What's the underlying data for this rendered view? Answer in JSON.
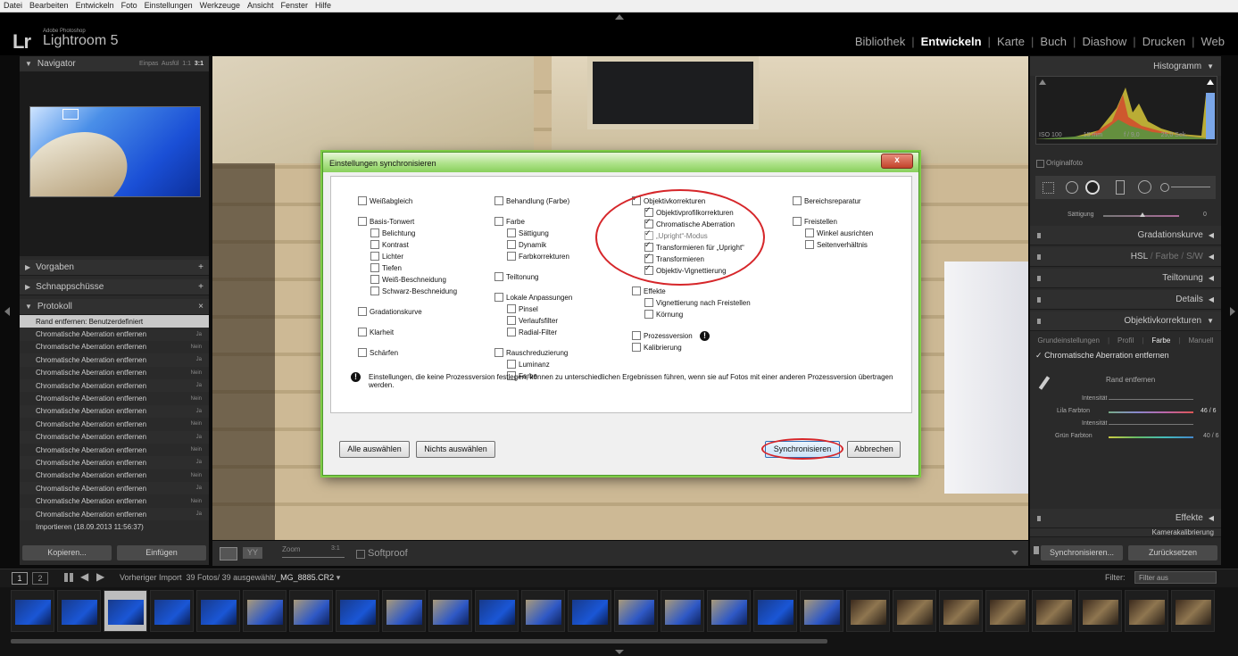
{
  "menubar": [
    "Datei",
    "Bearbeiten",
    "Entwickeln",
    "Foto",
    "Einstellungen",
    "Werkzeuge",
    "Ansicht",
    "Fenster",
    "Hilfe"
  ],
  "app": {
    "mark": "Lr",
    "small": "Adobe Photoshop",
    "name": "Lightroom 5"
  },
  "modules": [
    {
      "label": "Bibliothek",
      "active": false
    },
    {
      "label": "Entwickeln",
      "active": true
    },
    {
      "label": "Karte",
      "active": false
    },
    {
      "label": "Buch",
      "active": false
    },
    {
      "label": "Diashow",
      "active": false
    },
    {
      "label": "Drucken",
      "active": false
    },
    {
      "label": "Web",
      "active": false
    }
  ],
  "left": {
    "navigator": {
      "title": "Navigator",
      "opts": [
        "Einpas",
        "Ausfül",
        "1:1"
      ],
      "opt_active": "3:1"
    },
    "presets": "Vorgaben",
    "snapshots": "Schnappschüsse",
    "history": "Protokoll",
    "history_items": [
      {
        "label": "Rand entfernen: Benutzerdefiniert",
        "value": "",
        "selected": true
      },
      {
        "label": "Chromatische Aberration entfernen",
        "value": "Ja"
      },
      {
        "label": "Chromatische Aberration entfernen",
        "value": "Nein"
      },
      {
        "label": "Chromatische Aberration entfernen",
        "value": "Ja"
      },
      {
        "label": "Chromatische Aberration entfernen",
        "value": "Nein"
      },
      {
        "label": "Chromatische Aberration entfernen",
        "value": "Ja"
      },
      {
        "label": "Chromatische Aberration entfernen",
        "value": "Nein"
      },
      {
        "label": "Chromatische Aberration entfernen",
        "value": "Ja"
      },
      {
        "label": "Chromatische Aberration entfernen",
        "value": "Nein"
      },
      {
        "label": "Chromatische Aberration entfernen",
        "value": "Ja"
      },
      {
        "label": "Chromatische Aberration entfernen",
        "value": "Nein"
      },
      {
        "label": "Chromatische Aberration entfernen",
        "value": "Ja"
      },
      {
        "label": "Chromatische Aberration entfernen",
        "value": "Nein"
      },
      {
        "label": "Chromatische Aberration entfernen",
        "value": "Ja"
      },
      {
        "label": "Chromatische Aberration entfernen",
        "value": "Nein"
      },
      {
        "label": "Chromatische Aberration entfernen",
        "value": "Ja"
      },
      {
        "label": "Importieren (18.09.2013 11:56:37)",
        "value": ""
      }
    ],
    "copy_btn": "Kopieren...",
    "paste_btn": "Einfügen"
  },
  "toolbar": {
    "zoom": "Zoom",
    "zoom_val": "3:1",
    "softproof": "Softproof"
  },
  "right": {
    "histogram": "Histogramm",
    "exif": [
      "ISO 100",
      "15 mm",
      "f / 9,0",
      "25,0 Sek."
    ],
    "original": "Originalfoto",
    "saturation": "Sättigung",
    "saturation_val": "0",
    "tone_curve": "Gradationskurve",
    "hsl": [
      "HSL",
      "/",
      "Farbe",
      "/",
      "S/W"
    ],
    "split": "Teiltonung",
    "details": "Details",
    "lens": "Objektivkorrekturen",
    "lens_tabs": [
      "Grundeinstellungen",
      "|",
      "Profil",
      "|",
      "Farbe",
      "|",
      "Manuell"
    ],
    "ca_remove": "Chromatische Aberration entfernen",
    "defringe": "Rand entfernen",
    "intensity": "Intensität",
    "purple_hue": "Lila Farbton",
    "purple_val": "46 / 6",
    "intensity2": "Intensität",
    "green_hue": "Grün Farbton",
    "green_val": "40 / 6",
    "effects": "Effekte",
    "camera_cal": "Kamerakalibrierung",
    "sync_btn": "Synchronisieren...",
    "reset_btn": "Zurücksetzen"
  },
  "filmbar": {
    "views": [
      "1",
      "2"
    ],
    "source": "Vorheriger Import",
    "count": "39 Fotos/ 39 ausgewählt/",
    "file": "_MG_8885.CR2",
    "filter_label": "Filter:",
    "filter_val": "Filter aus"
  },
  "dialog": {
    "title": "Einstellungen synchronisieren",
    "close": "x",
    "col1": [
      {
        "label": "Weißabgleich",
        "checked": false,
        "indent": 0
      },
      {
        "label": "Basis-Tonwert",
        "checked": false,
        "indent": 0
      },
      {
        "label": "Belichtung",
        "checked": false,
        "indent": 1
      },
      {
        "label": "Kontrast",
        "checked": false,
        "indent": 1
      },
      {
        "label": "Lichter",
        "checked": false,
        "indent": 1
      },
      {
        "label": "Tiefen",
        "checked": false,
        "indent": 1
      },
      {
        "label": "Weiß-Beschneidung",
        "checked": false,
        "indent": 1
      },
      {
        "label": "Schwarz-Beschneidung",
        "checked": false,
        "indent": 1
      },
      {
        "label": "Gradationskurve",
        "checked": false,
        "indent": 0
      },
      {
        "label": "Klarheit",
        "checked": false,
        "indent": 0
      },
      {
        "label": "Schärfen",
        "checked": false,
        "indent": 0
      }
    ],
    "col2": [
      {
        "label": "Behandlung (Farbe)",
        "checked": false,
        "indent": 0
      },
      {
        "label": "Farbe",
        "checked": false,
        "indent": 0
      },
      {
        "label": "Sättigung",
        "checked": false,
        "indent": 1
      },
      {
        "label": "Dynamik",
        "checked": false,
        "indent": 1
      },
      {
        "label": "Farbkorrekturen",
        "checked": false,
        "indent": 1
      },
      {
        "label": "Teiltonung",
        "checked": false,
        "indent": 0
      },
      {
        "label": "Lokale Anpassungen",
        "checked": false,
        "indent": 0
      },
      {
        "label": "Pinsel",
        "checked": false,
        "indent": 1
      },
      {
        "label": "Verlaufsfilter",
        "checked": false,
        "indent": 1
      },
      {
        "label": "Radial-Filter",
        "checked": false,
        "indent": 1
      },
      {
        "label": "Rauschreduzierung",
        "checked": false,
        "indent": 0
      },
      {
        "label": "Luminanz",
        "checked": false,
        "indent": 1
      },
      {
        "label": "Farbe",
        "checked": false,
        "indent": 1
      }
    ],
    "col3": [
      {
        "label": "Objektivkorrekturen",
        "checked": true,
        "indent": 0
      },
      {
        "label": "Objektivprofilkorrekturen",
        "checked": true,
        "indent": 1
      },
      {
        "label": "Chromatische Aberration",
        "checked": true,
        "indent": 1
      },
      {
        "label": "„Upright“-Modus",
        "checked": true,
        "indent": 1,
        "dim": true
      },
      {
        "label": "Transformieren für „Upright“",
        "checked": true,
        "indent": 1
      },
      {
        "label": "Transformieren",
        "checked": true,
        "indent": 1
      },
      {
        "label": "Objektiv-Vignettierung",
        "checked": true,
        "indent": 1
      },
      {
        "label": "Effekte",
        "checked": false,
        "indent": 0
      },
      {
        "label": "Vignettierung nach Freistellen",
        "checked": false,
        "indent": 1
      },
      {
        "label": "Körnung",
        "checked": false,
        "indent": 1
      },
      {
        "label": "Prozessversion",
        "checked": false,
        "indent": 0
      },
      {
        "label": "Kalibrierung",
        "checked": false,
        "indent": 0
      }
    ],
    "col4": [
      {
        "label": "Bereichsreparatur",
        "checked": false,
        "indent": 0
      },
      {
        "label": "Freistellen",
        "checked": false,
        "indent": 0
      },
      {
        "label": "Winkel ausrichten",
        "checked": false,
        "indent": 1
      },
      {
        "label": "Seitenverhältnis",
        "checked": false,
        "indent": 1
      }
    ],
    "info": "Einstellungen, die keine Prozessversion festlegen, können zu unterschiedlichen Ergebnissen führen, wenn sie auf Fotos mit einer anderen Prozessversion übertragen werden.",
    "select_all": "Alle auswählen",
    "select_none": "Nichts auswählen",
    "sync": "Synchronisieren",
    "cancel": "Abbrechen"
  },
  "colors": {
    "accent_green": "#7ecb46",
    "annotation_red": "#d6262a",
    "panel": "#2a2a2a"
  }
}
